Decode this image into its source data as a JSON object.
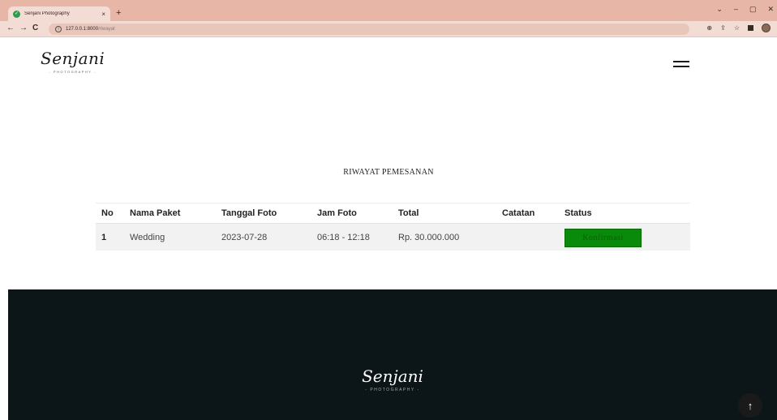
{
  "browser": {
    "tab_title": "Senjani Photography",
    "tab_close": "×",
    "new_tab": "+",
    "url_host": "127.0.0.1:8000",
    "url_path": "/riwayat"
  },
  "header": {
    "logo_text": "Senjani",
    "logo_sub": "- PHOTOGRAPHY -"
  },
  "main": {
    "title": "RIWAYAT PEMESANAN",
    "table": {
      "headers": [
        "No",
        "Nama Paket",
        "Tanggal Foto",
        "Jam Foto",
        "Total",
        "Catatan",
        "Status"
      ],
      "rows": [
        {
          "no": "1",
          "paket": "Wedding",
          "tanggal": "2023-07-28",
          "jam": "06:18 - 12:18",
          "total": "Rp. 30.000.000",
          "catatan": "",
          "status": "Konfirmasi"
        }
      ]
    },
    "status_color": "#0a8a0a"
  },
  "footer": {
    "logo_text": "Senjani",
    "logo_sub": "- PHOTOGRAPHY -",
    "back_to_top_icon": "arrow-up-icon"
  }
}
